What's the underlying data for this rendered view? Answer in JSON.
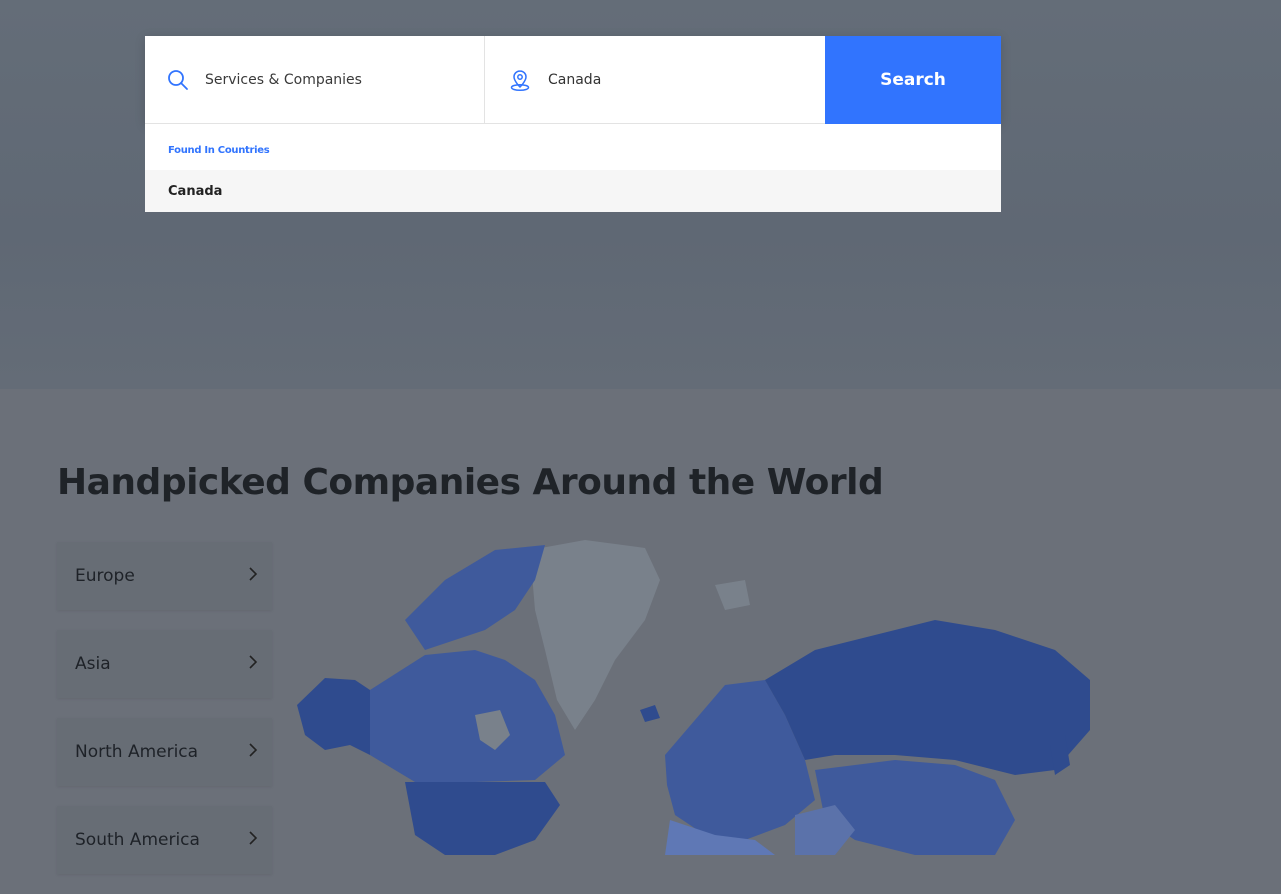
{
  "search": {
    "services_placeholder": "Services & Companies",
    "location_value": "Canada",
    "button_label": "Search"
  },
  "dropdown": {
    "group_label": "Found In Countries",
    "options": [
      "Canada"
    ]
  },
  "section": {
    "heading": "Handpicked Companies Around the World"
  },
  "regions": [
    {
      "label": "Europe"
    },
    {
      "label": "Asia"
    },
    {
      "label": "North America"
    },
    {
      "label": "South America"
    }
  ],
  "icons": {
    "search": "search-icon",
    "location": "location-pin-icon",
    "chevron": "chevron-right-icon"
  },
  "colors": {
    "accent": "#3174fe",
    "map_highlight": "#2f4b8e",
    "map_muted": "#79818b"
  }
}
